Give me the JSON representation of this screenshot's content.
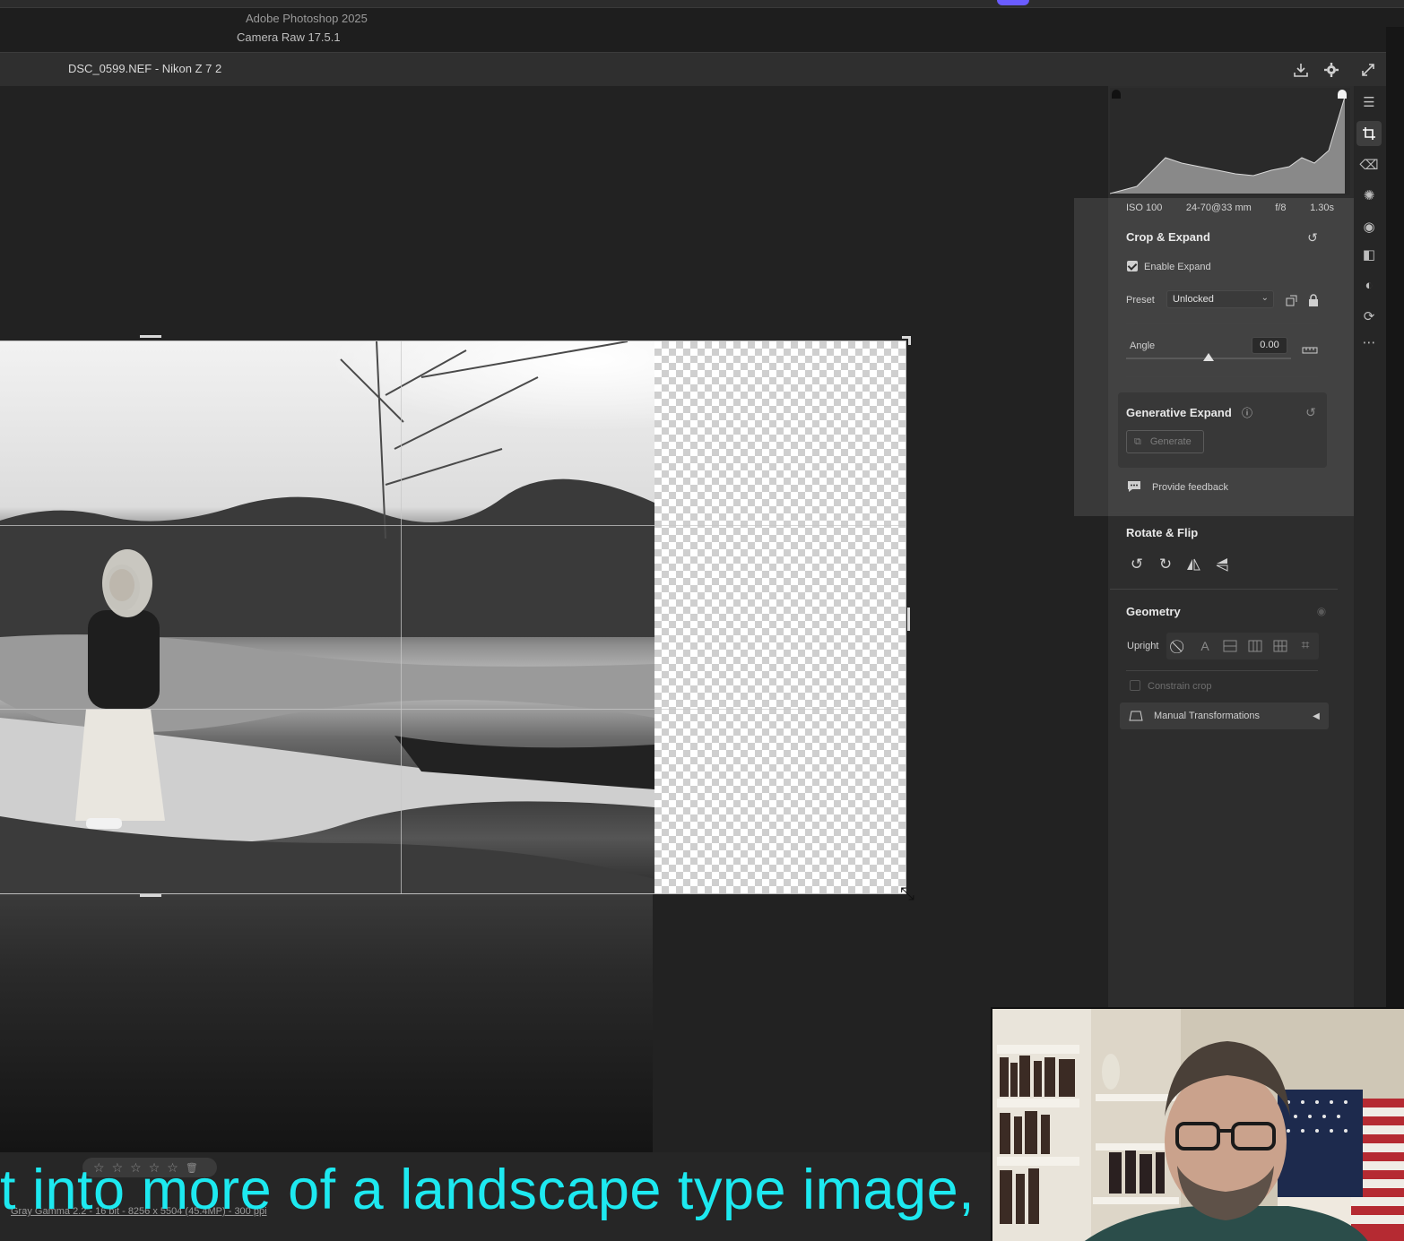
{
  "app": {
    "name": "Adobe Photoshop 2025",
    "plugin_version": "Camera Raw 17.5.1",
    "file_title": "DSC_0599.NEF  -  Nikon Z 7 2"
  },
  "header_icons": [
    "download-icon",
    "gear-icon",
    "expand-icon"
  ],
  "histogram": {
    "exif": {
      "iso": "ISO 100",
      "lens": "24-70@33 mm",
      "aperture": "f/8",
      "shutter": "1.30s"
    }
  },
  "crop_expand": {
    "title": "Crop & Expand",
    "enable_expand_label": "Enable Expand",
    "enable_expand_checked": true,
    "preset_label": "Preset",
    "preset_value": "Unlocked",
    "angle_label": "Angle",
    "angle_value": "0.00",
    "angle_slider_fraction": 0.5
  },
  "generative_expand": {
    "title": "Generative Expand",
    "generate_label": "Generate",
    "feedback_label": "Provide feedback"
  },
  "rotate_flip": {
    "title": "Rotate & Flip",
    "icons": [
      "rotate-left-icon",
      "rotate-right-icon",
      "flip-horizontal-icon",
      "flip-vertical-icon"
    ]
  },
  "geometry": {
    "title": "Geometry",
    "upright_label": "Upright",
    "constrain_label": "Constrain crop",
    "manual_label": "Manual Transformations"
  },
  "toolstrip": [
    "edit-sliders-icon",
    "crop-icon",
    "eraser-icon",
    "healing-icon",
    "redeye-icon",
    "masking-icon",
    "presets-icon",
    "snapshots-icon",
    "more-icon"
  ],
  "bottom": {
    "stars": [
      "☆",
      "☆",
      "☆",
      "☆",
      "☆"
    ],
    "image_info": "Gray Gamma 2.2 - 16 bit - 8256 x 5504 (45.4MP) - 300 ppi",
    "caption": "t into more of a landscape type image,"
  },
  "colors": {
    "caption": "#1de9f0",
    "panel_bg": "#2d2d2d",
    "canvas_bg": "#222222"
  }
}
